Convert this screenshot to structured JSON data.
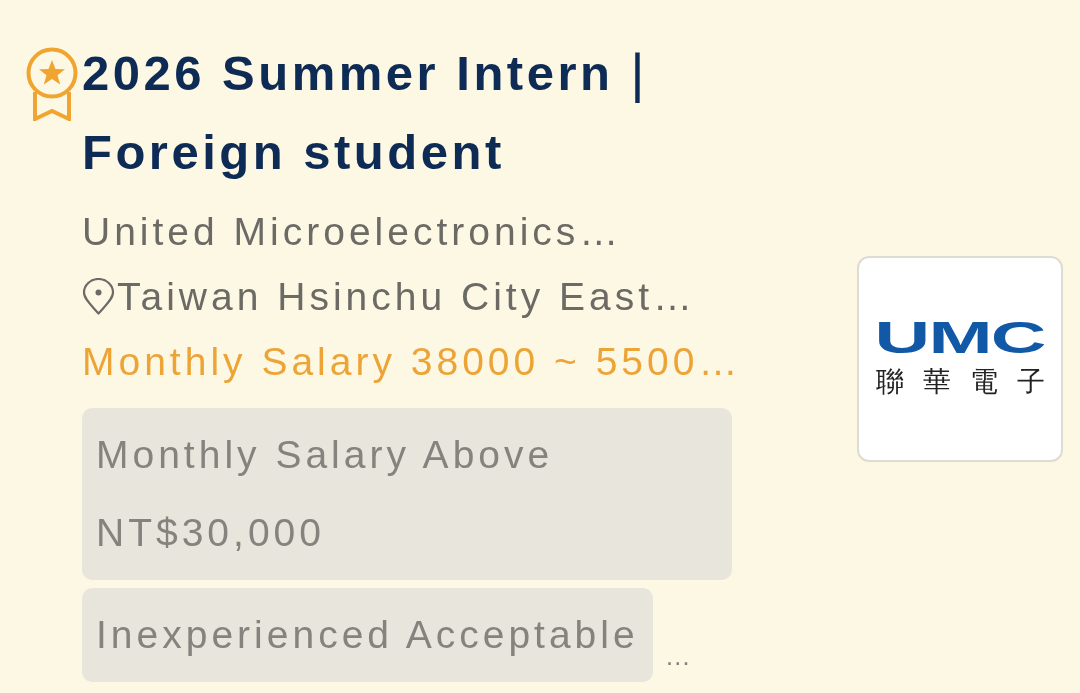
{
  "job": {
    "title": "2026 Summer Intern｜Foreign student",
    "company": "United Microelectronics…",
    "location": "Taiwan Hsinchu City East…",
    "salary": "Monthly Salary 38000 ~ 5500…",
    "tags": [
      {
        "label": "Monthly Salary Above NT$30,000"
      },
      {
        "label": "Inexperienced Acceptable"
      }
    ],
    "more": "…"
  },
  "logo": {
    "text": "UMC",
    "subtext": "聯華電子"
  }
}
